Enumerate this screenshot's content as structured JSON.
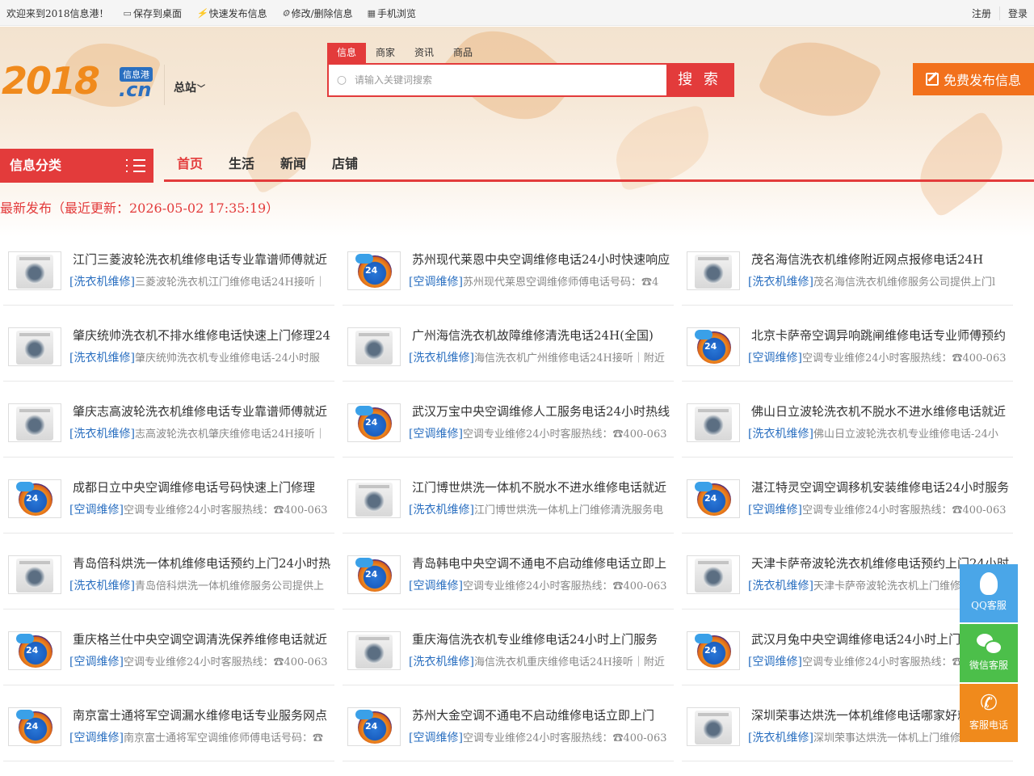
{
  "topbar": {
    "welcome": "欢迎来到2018信息港！",
    "save_desktop": "保存到桌面",
    "quick_post": "快速发布信息",
    "edit_delete": "修改/删除信息",
    "mobile": "手机浏览",
    "register": "注册",
    "login": "登录"
  },
  "logo": {
    "number": "2018",
    "tag": "信息港",
    "domain": ".cn"
  },
  "site": {
    "label": "总站"
  },
  "search": {
    "tabs": [
      "信息",
      "商家",
      "资讯",
      "商品"
    ],
    "active_tab": "信息",
    "placeholder": "请输入关键词搜索",
    "button": "搜 索"
  },
  "publish_button": "免费发布信息",
  "category_nav": {
    "label": "信息分类"
  },
  "main_nav": [
    "首页",
    "生活",
    "新闻",
    "店铺"
  ],
  "latest": {
    "heading": "最新发布（最近更新：2026-05-02 17:35:19）"
  },
  "listings": [
    {
      "type": "washer",
      "title": "江门三菱波轮洗衣机维修电话专业靠谱师傅就近",
      "category": "[洗衣机维修]",
      "desc": "三菱波轮洗衣机江门维修电话24H接听｜"
    },
    {
      "type": "ac",
      "title": "苏州现代莱恩中央空调维修电话24小时快速响应",
      "category": "[空调维修]",
      "desc": "苏州现代莱恩空调维修师傅电话号码：☎4"
    },
    {
      "type": "washer",
      "title": "茂名海信洗衣机维修附近网点报修电话24H",
      "category": "[洗衣机维修]",
      "desc": "茂名海信洗衣机维修服务公司提供上门l"
    },
    {
      "type": "washer",
      "title": "肇庆统帅洗衣机不排水维修电话快速上门修理24",
      "category": "[洗衣机维修]",
      "desc": "肇庆统帅洗衣机专业维修电话-24小时服"
    },
    {
      "type": "washer",
      "title": "广州海信洗衣机故障维修清洗电话24H(全国)",
      "category": "[洗衣机维修]",
      "desc": "海信洗衣机广州维修电话24H接听｜附近"
    },
    {
      "type": "ac",
      "title": "北京卡萨帝空调异响跳闸维修电话专业师傅预约",
      "category": "[空调维修]",
      "desc": "空调专业维修24小时客服热线：☎400-063"
    },
    {
      "type": "washer",
      "title": "肇庆志高波轮洗衣机维修电话专业靠谱师傅就近",
      "category": "[洗衣机维修]",
      "desc": "志高波轮洗衣机肇庆维修电话24H接听｜"
    },
    {
      "type": "ac",
      "title": "武汉万宝中央空调维修人工服务电话24小时热线",
      "category": "[空调维修]",
      "desc": "空调专业维修24小时客服热线：☎400-063"
    },
    {
      "type": "washer",
      "title": "佛山日立波轮洗衣机不脱水不进水维修电话就近",
      "category": "[洗衣机维修]",
      "desc": "佛山日立波轮洗衣机专业维修电话-24小"
    },
    {
      "type": "ac",
      "title": "成都日立中央空调维修电话号码快速上门修理",
      "category": "[空调维修]",
      "desc": "空调专业维修24小时客服热线：☎400-063"
    },
    {
      "type": "washer",
      "title": "江门博世烘洗一体机不脱水不进水维修电话就近",
      "category": "[洗衣机维修]",
      "desc": "江门博世烘洗一体机上门维修清洗服务电"
    },
    {
      "type": "ac",
      "title": "湛江特灵空调空调移机安装维修电话24小时服务",
      "category": "[空调维修]",
      "desc": "空调专业维修24小时客服热线：☎400-063"
    },
    {
      "type": "washer",
      "title": "青岛倍科烘洗一体机维修电话预约上门24小时热",
      "category": "[洗衣机维修]",
      "desc": "青岛倍科烘洗一体机维修服务公司提供上"
    },
    {
      "type": "ac",
      "title": "青岛韩电中央空调不通电不启动维修电话立即上",
      "category": "[空调维修]",
      "desc": "空调专业维修24小时客服热线：☎400-063"
    },
    {
      "type": "washer",
      "title": "天津卡萨帝波轮洗衣机维修电话预约上门24小时",
      "category": "[洗衣机维修]",
      "desc": "天津卡萨帝波轮洗衣机上门维修清洗服"
    },
    {
      "type": "ac",
      "title": "重庆格兰仕中央空调空调清洗保养维修电话就近",
      "category": "[空调维修]",
      "desc": "空调专业维修24小时客服热线：☎400-063"
    },
    {
      "type": "washer",
      "title": "重庆海信洗衣机专业维修电话24小时上门服务",
      "category": "[洗衣机维修]",
      "desc": "海信洗衣机重庆维修电话24H接听｜附近"
    },
    {
      "type": "ac",
      "title": "武汉月兔中央空调维修电话24小时上门服务",
      "category": "[空调维修]",
      "desc": "空调专业维修24小时客服热线：☎400-063"
    },
    {
      "type": "ac",
      "title": "南京富士通将军空调漏水维修电话专业服务网点",
      "category": "[空调维修]",
      "desc": "南京富士通将军空调维修师傅电话号码：☎"
    },
    {
      "type": "ac",
      "title": "苏州大金空调不通电不启动维修电话立即上门",
      "category": "[空调维修]",
      "desc": "空调专业维修24小时客服热线：☎400-063"
    },
    {
      "type": "washer",
      "title": "深圳荣事达烘洗一体机维修电话哪家好就近",
      "category": "[洗衣机维修]",
      "desc": "深圳荣事达烘洗一体机上门维修清洗服"
    }
  ],
  "float_service": {
    "qq": "QQ客服",
    "wechat": "微信客服",
    "phone": "客服电话"
  }
}
